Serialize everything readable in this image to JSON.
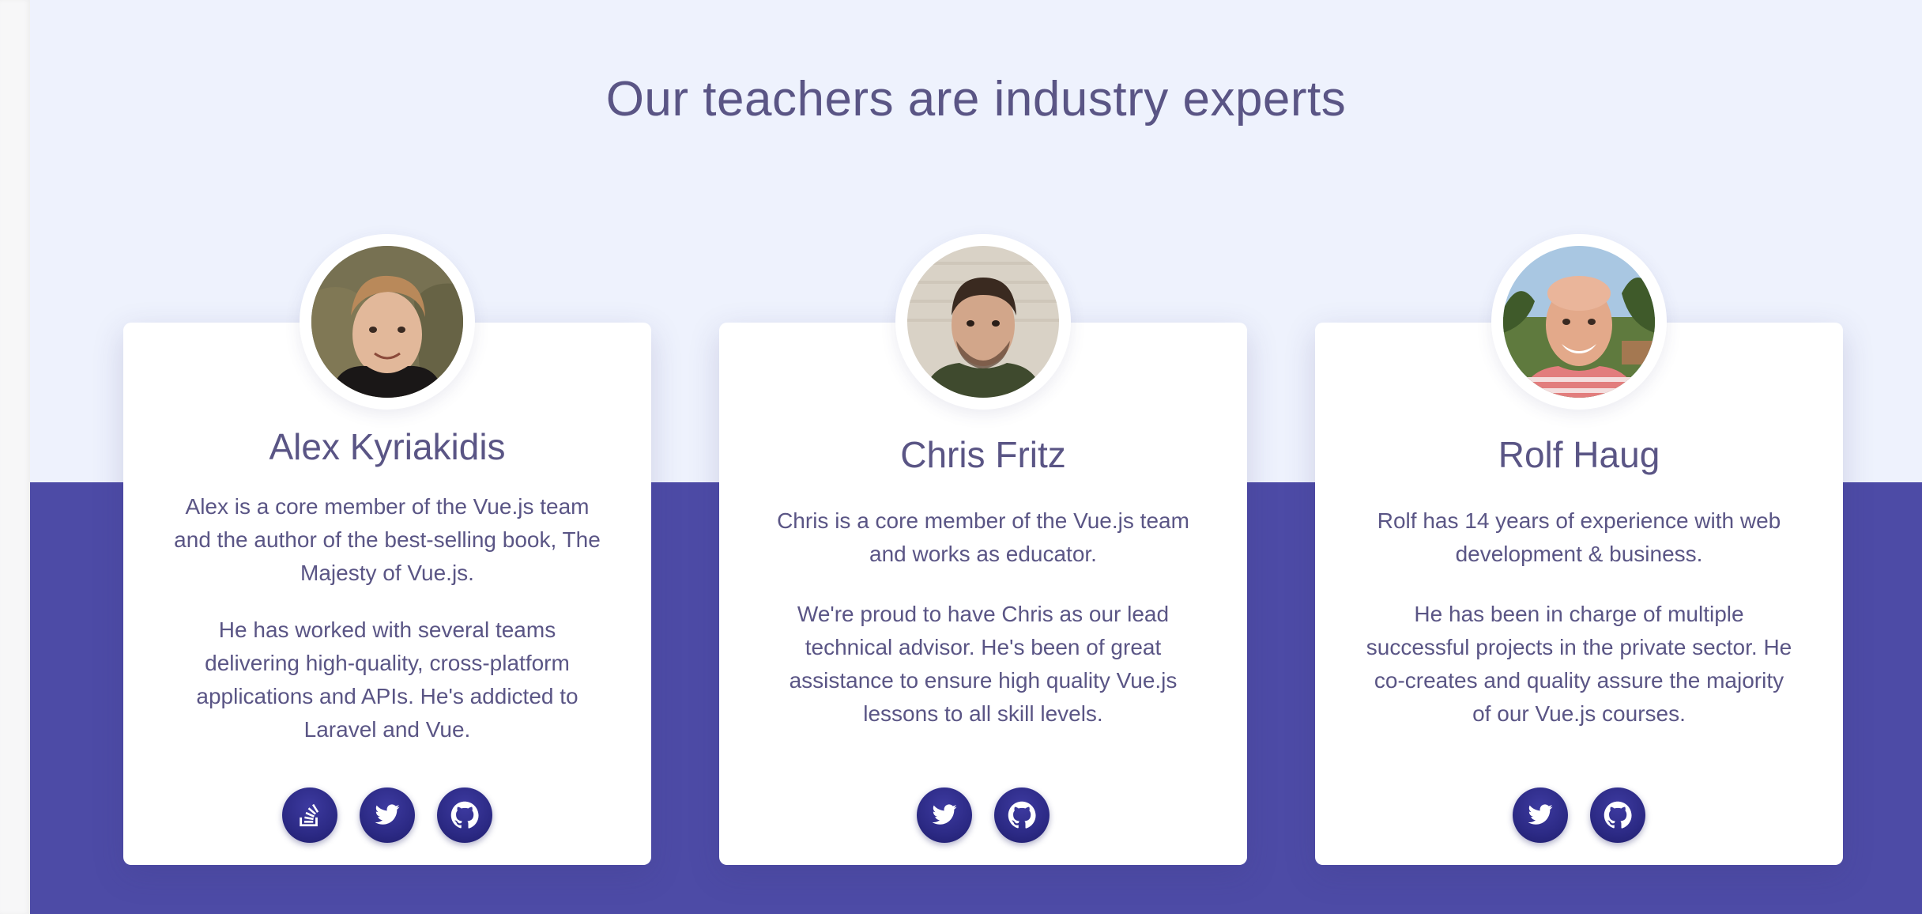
{
  "section": {
    "heading": "Our teachers are industry experts"
  },
  "teachers": [
    {
      "name": "Alex Kyriakidis",
      "bio_1": "Alex is a core member of the Vue.js team and the author of the best-selling book, The Majesty of Vue.js.",
      "bio_2": "He has worked with several teams delivering high-quality, cross-platform applications and APIs. He's addicted to Laravel and Vue.",
      "socials": [
        "stackoverflow-icon",
        "twitter-icon",
        "github-icon"
      ]
    },
    {
      "name": "Chris Fritz",
      "bio_1": "Chris is a core member of the Vue.js team and works as educator.",
      "bio_2": "We're proud to have Chris as our lead technical advisor. He's been of great assistance to ensure high quality Vue.js lessons to all skill levels.",
      "socials": [
        "twitter-icon",
        "github-icon"
      ]
    },
    {
      "name": "Rolf Haug",
      "bio_1": "Rolf has 14 years of experience with web development & business.",
      "bio_2": "He has been in charge of multiple successful projects in the private sector. He co-creates and quality assure the majority of our Vue.js courses.",
      "socials": [
        "twitter-icon",
        "github-icon"
      ]
    }
  ],
  "colors": {
    "top_background": "#eef2fd",
    "bottom_background": "#4d4ba6",
    "text": "#5a5585",
    "social_button": "#2c2a85"
  }
}
